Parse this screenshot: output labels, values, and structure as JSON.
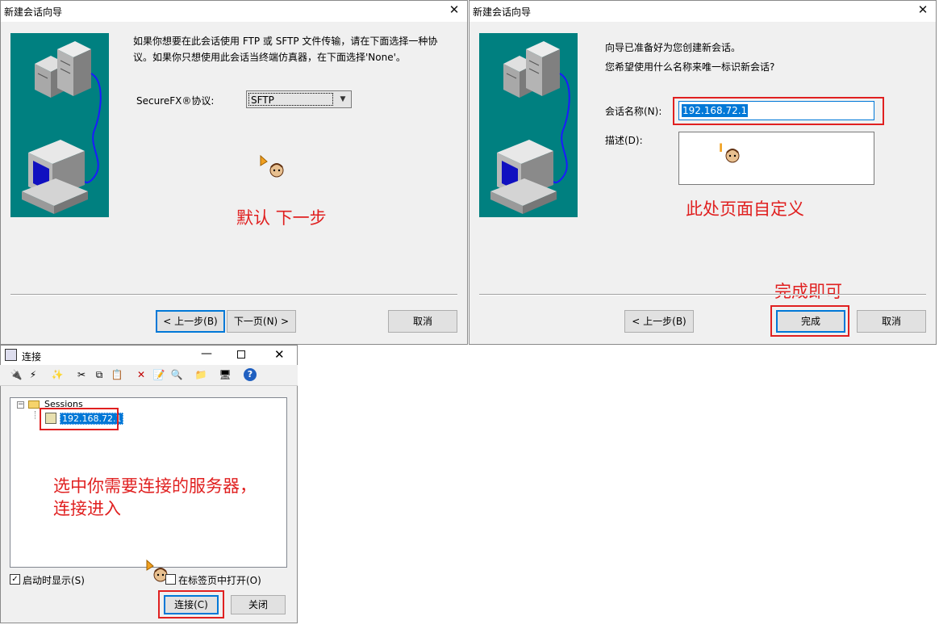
{
  "wizard1": {
    "title": "新建会话向导",
    "desc_line1": "如果你想要在此会话使用 FTP 或 SFTP 文件传输，请在下面选择一种协",
    "desc_line2": "议。如果你只想使用此会话当终端仿真器，在下面选择'None'。",
    "protocol_label": "SecureFX®协议:",
    "protocol_value": "SFTP",
    "back_button": "< 上一步(B)",
    "next_button": "下一页(N) >",
    "cancel_button": "取消",
    "annotation": "默认 下一步"
  },
  "wizard2": {
    "title": "新建会话向导",
    "line1": "向导已准备好为您创建新会话。",
    "line2": "您希望使用什么名称来唯一标识新会话?",
    "session_name_label": "会话名称(N):",
    "session_name_value": "192.168.72.1",
    "description_label": "描述(D):",
    "back_button": "< 上一步(B)",
    "finish_button": "完成",
    "cancel_button": "取消",
    "annotation_page": "此处页面自定义",
    "annotation_finish": "完成即可"
  },
  "connect": {
    "title": "连接",
    "tree_root": "Sessions",
    "tree_item": "192.168.72.1",
    "annotation_line1": "选中你需要连接的服务器，",
    "annotation_line2": "连接进入",
    "show_on_startup": "启动时显示(S)",
    "open_in_tab": "在标签页中打开(O)",
    "connect_button": "连接(C)",
    "close_button": "关闭"
  },
  "colors": {
    "annotation_red": "#e02020",
    "illustration_teal": "#008080",
    "selection_blue": "#0078d7"
  },
  "icons": [
    "close-icon",
    "minimize-icon",
    "maximize-icon",
    "server-icon",
    "computer-icon",
    "cursor-icon",
    "folder-icon",
    "session-icon"
  ]
}
